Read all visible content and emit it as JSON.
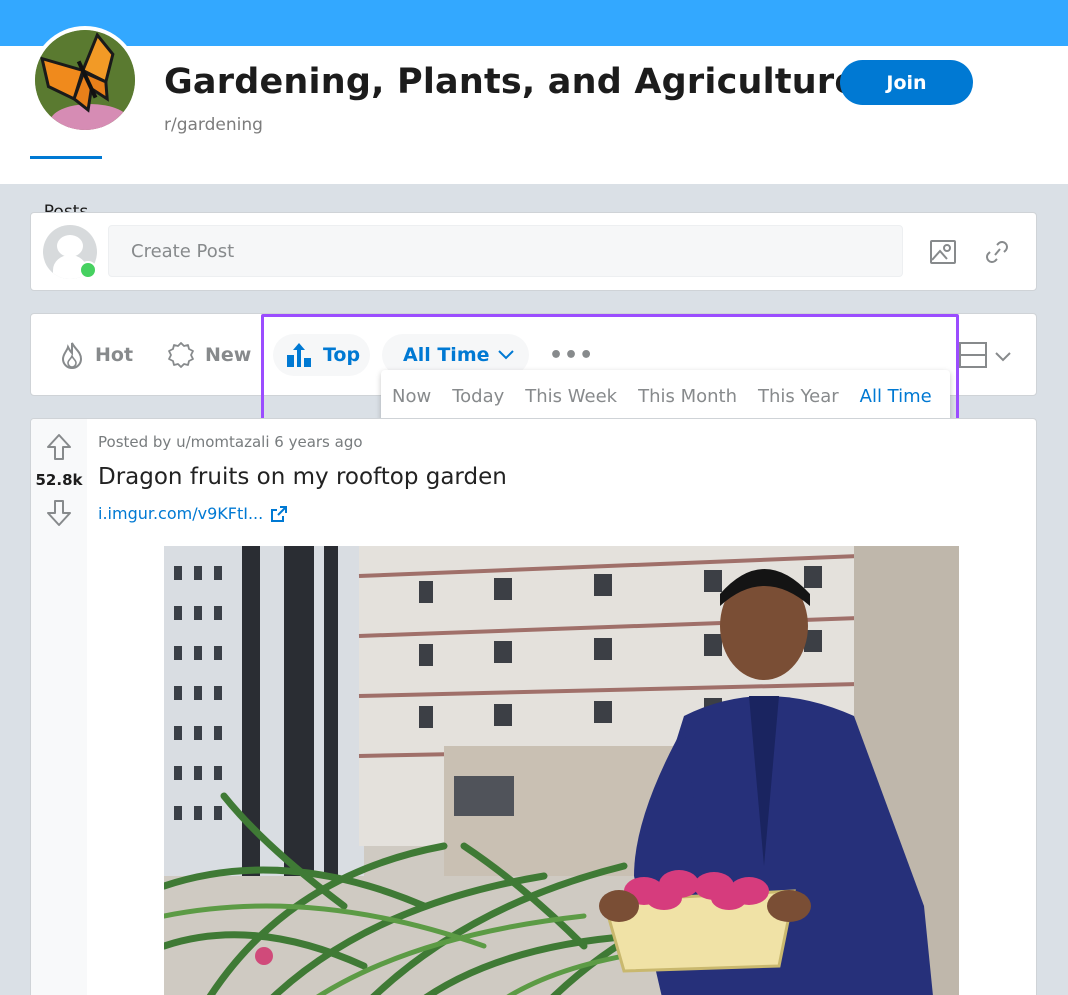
{
  "header": {
    "title": "Gardening, Plants, and Agriculture.",
    "subreddit": "r/gardening",
    "join_label": "Join",
    "tab_posts": "Posts"
  },
  "create_post": {
    "placeholder": "Create Post"
  },
  "sort": {
    "hot": "Hot",
    "new": "New",
    "top": "Top",
    "time_selected": "All Time",
    "more": "•••",
    "time_options": [
      "Now",
      "Today",
      "This Week",
      "This Month",
      "This Year",
      "All Time"
    ]
  },
  "post": {
    "meta": "Posted by u/momtazali 6 years ago",
    "score": "52.8k",
    "title": "Dragon fruits on my rooftop garden",
    "link": "i.imgur.com/v9KFtI..."
  },
  "colors": {
    "banner": "#33a8ff",
    "accent": "#0079d3",
    "highlight": "#9b4dff",
    "online": "#46d160"
  },
  "icons": [
    "hot-icon",
    "new-icon",
    "top-icon",
    "chevron-down-icon",
    "card-view-icon",
    "image-icon",
    "link-icon",
    "upvote-icon",
    "downvote-icon",
    "external-link-icon"
  ]
}
